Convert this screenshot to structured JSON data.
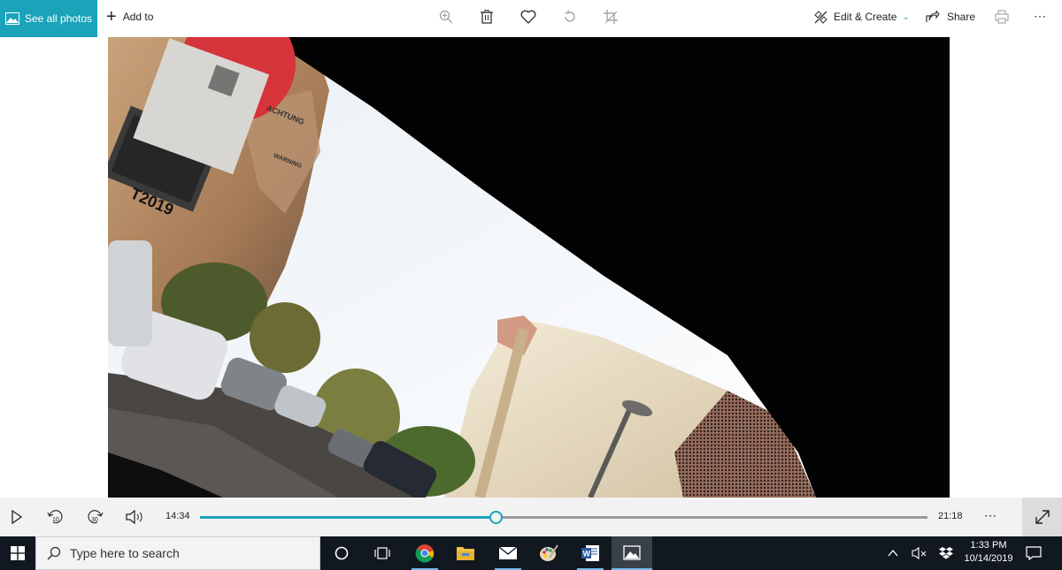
{
  "toolbar": {
    "see_all_photos": "See all photos",
    "add_to": "Add to",
    "edit_create": "Edit & Create",
    "share": "Share",
    "icons": [
      "zoom-in-icon",
      "delete-icon",
      "favorite-icon",
      "rotate-icon",
      "crop-icon",
      "print-icon",
      "more-icon"
    ],
    "accent_color": "#1aa3b9"
  },
  "video": {
    "sticker_header": "ACHTUNG",
    "sticker_warning": "WARNING",
    "permit_label": "T2019"
  },
  "playback": {
    "current_time": "14:34",
    "total_time": "21:18",
    "progress": 0.406,
    "skip_back_label": "10",
    "skip_forward_label": "30"
  },
  "taskbar": {
    "search_placeholder": "Type here to search",
    "time": "1:33 PM",
    "date": "10/14/2019",
    "apps": [
      "cortana",
      "task-view",
      "chrome",
      "file-explorer",
      "mail",
      "paint",
      "word",
      "photos"
    ]
  }
}
